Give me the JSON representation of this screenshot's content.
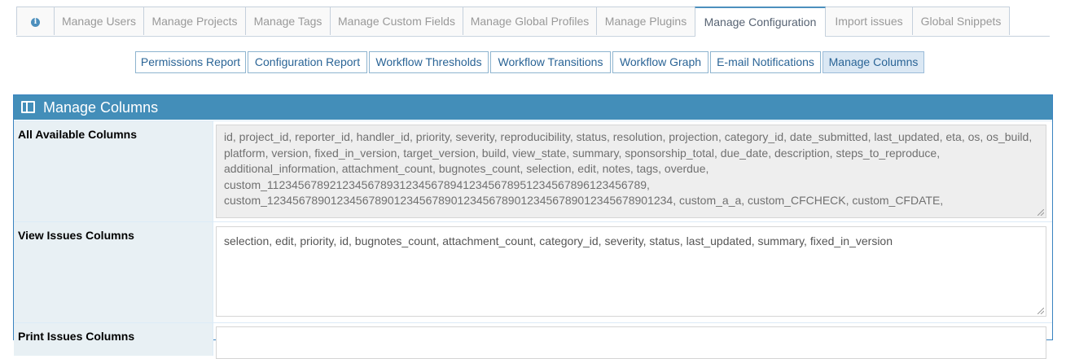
{
  "tabs": [
    {
      "label": "",
      "icon": "info-icon"
    },
    {
      "label": "Manage Users"
    },
    {
      "label": "Manage Projects"
    },
    {
      "label": "Manage Tags"
    },
    {
      "label": "Manage Custom Fields"
    },
    {
      "label": "Manage Global Profiles"
    },
    {
      "label": "Manage Plugins"
    },
    {
      "label": "Manage Configuration",
      "active": true
    },
    {
      "label": "Import issues"
    },
    {
      "label": "Global Snippets"
    }
  ],
  "subnav": [
    {
      "label": "Permissions Report"
    },
    {
      "label": "Configuration Report"
    },
    {
      "label": "Workflow Thresholds"
    },
    {
      "label": "Workflow Transitions"
    },
    {
      "label": "Workflow Graph"
    },
    {
      "label": "E-mail Notifications"
    },
    {
      "label": "Manage Columns",
      "active": true
    }
  ],
  "widget": {
    "title": "Manage Columns",
    "icon": "columns-icon",
    "header_color": "#438eb9"
  },
  "rows": [
    {
      "label": "All Available Columns",
      "value": "id, project_id, reporter_id, handler_id, priority, severity, reproducibility, status, resolution, projection, category_id, date_submitted, last_updated, eta, os, os_build, platform, version, fixed_in_version, target_version, build, view_state, summary, sponsorship_total, due_date, description, steps_to_reproduce, additional_information, attachment_count, bugnotes_count, selection, edit, notes, tags, overdue, custom_1123456789212345678931234567894123456789512345678961234567 89,\ncustom_12345678901234567890123456789012345678901234567890123456789012 34, custom_a_a, custom_CFCHECK, custom_CFDATE,",
      "readonly": true
    },
    {
      "label": "View Issues Columns",
      "value": "selection, edit, priority, id, bugnotes_count, attachment_count, category_id, severity, status, last_updated, summary, fixed_in_version",
      "readonly": false
    },
    {
      "label": "Print Issues Columns",
      "value": "",
      "readonly": false
    }
  ],
  "colors": {
    "accent": "#438eb9",
    "label_bg": "#e8f0f4",
    "readonly_bg": "#eeeeee"
  }
}
